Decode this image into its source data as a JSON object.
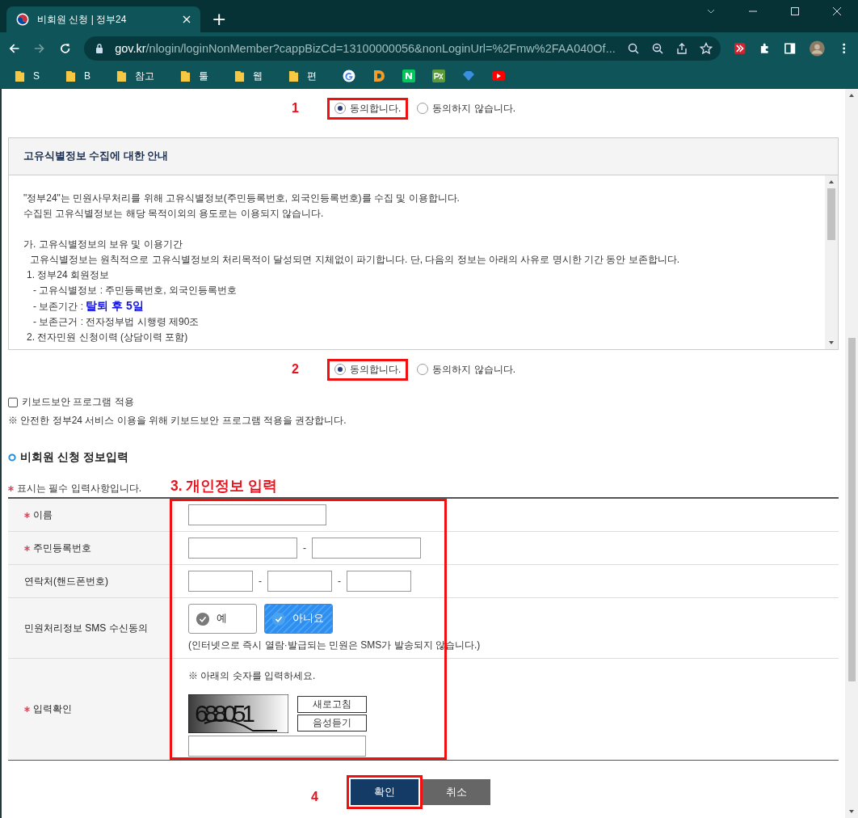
{
  "browser": {
    "tab_title": "비회원 신청 | 정부24",
    "new_tab": "+",
    "url_host": "gov.kr",
    "url_path": "/nlogin/loginNonMember?cappBizCd=13100000056&nonLoginUrl=%2Fmw%2FAA040Of...",
    "bookmarks": [
      {
        "kind": "folder",
        "label": "S"
      },
      {
        "kind": "folder",
        "label": "B"
      },
      {
        "kind": "folder",
        "label": "참고"
      },
      {
        "kind": "folder",
        "label": "툴"
      },
      {
        "kind": "folder",
        "label": "웹"
      },
      {
        "kind": "folder",
        "label": "편"
      },
      {
        "kind": "google"
      },
      {
        "kind": "d-logo"
      },
      {
        "kind": "n-logo"
      },
      {
        "kind": "px-logo"
      },
      {
        "kind": "diamond"
      },
      {
        "kind": "play"
      }
    ]
  },
  "consent_1": {
    "step": "1",
    "options": [
      {
        "label": "동의합니다.",
        "selected": true,
        "highlighted": true
      },
      {
        "label": "동의하지 않습니다.",
        "selected": false,
        "highlighted": false
      }
    ]
  },
  "notice": {
    "title": "고유식별정보 수집에 대한 안내",
    "lines": [
      {
        "kind": "text",
        "text": "\"정부24\"는 민원사무처리를 위해 고유식별정보(주민등록번호, 외국인등록번호)를 수집 및 이용합니다."
      },
      {
        "kind": "text",
        "text": "수집된 고유식별정보는 해당 목적이외의 용도로는 이용되지 않습니다."
      },
      {
        "kind": "gap"
      },
      {
        "kind": "text",
        "text": "가. 고유식별정보의 보유 및 이용기간"
      },
      {
        "kind": "body",
        "text": "고유식별정보는 원칙적으로 고유식별정보의 처리목적이 달성되면 지체없이 파기합니다. 단, 다음의 정보는 아래의 사유로 명시한 기간 동안 보존합니다."
      },
      {
        "kind": "item",
        "text": "1. 정부24 회원정보"
      },
      {
        "kind": "sub",
        "text": "- 고유식별정보 : 주민등록번호, 외국인등록번호"
      },
      {
        "kind": "sub",
        "text": "- 보존기간 : **탈퇴 후 5일**"
      },
      {
        "kind": "sub",
        "text": "- 보존근거 : 전자정부법 시행령 제90조"
      },
      {
        "kind": "item",
        "text": "2. 전자민원 신청이력 (상담이력 포함)"
      }
    ]
  },
  "consent_2": {
    "step": "2",
    "options": [
      {
        "label": "동의합니다.",
        "selected": true,
        "highlighted": true
      },
      {
        "label": "동의하지 않습니다.",
        "selected": false,
        "highlighted": false
      }
    ]
  },
  "keyboard_security": {
    "label": "키보드보안 프로그램 적용",
    "checked": false,
    "note": "※ 안전한 정부24 서비스 이용을 위해 키보드보안 프로그램 적용을 권장합니다."
  },
  "form": {
    "section_title": "비회원 신청 정보입력",
    "required_note": "표시는 필수 입력사항입니다.",
    "step_label": "3. 개인정보 입력",
    "highlighted": true,
    "rows": [
      {
        "kind": "text",
        "label": "이름",
        "required": true
      },
      {
        "kind": "ssn",
        "label": "주민등록번호",
        "required": true,
        "separator": "-"
      },
      {
        "kind": "phone",
        "label": "연락처(핸드폰번호)",
        "required": false,
        "separators": [
          "-",
          "-"
        ]
      },
      {
        "kind": "sms",
        "label": "민원처리정보 SMS 수신동의",
        "required": false,
        "options": [
          {
            "label": "예",
            "selected": false
          },
          {
            "label": "아니요",
            "selected": true
          }
        ],
        "note": "(인터넷으로 즉시 열람·발급되는 민원은 SMS가 발송되지 않습니다.)"
      },
      {
        "kind": "captcha",
        "label": "입력확인",
        "required": true,
        "instruction": "※ 아래의 숫자를 입력하세요.",
        "captcha": "688051",
        "buttons": [
          "새로고침",
          "음성듣기"
        ]
      }
    ]
  },
  "actions": {
    "step": "4",
    "buttons": [
      {
        "label": "확인",
        "kind": "primary",
        "highlighted": true
      },
      {
        "label": "취소",
        "kind": "secondary",
        "highlighted": false
      }
    ]
  }
}
